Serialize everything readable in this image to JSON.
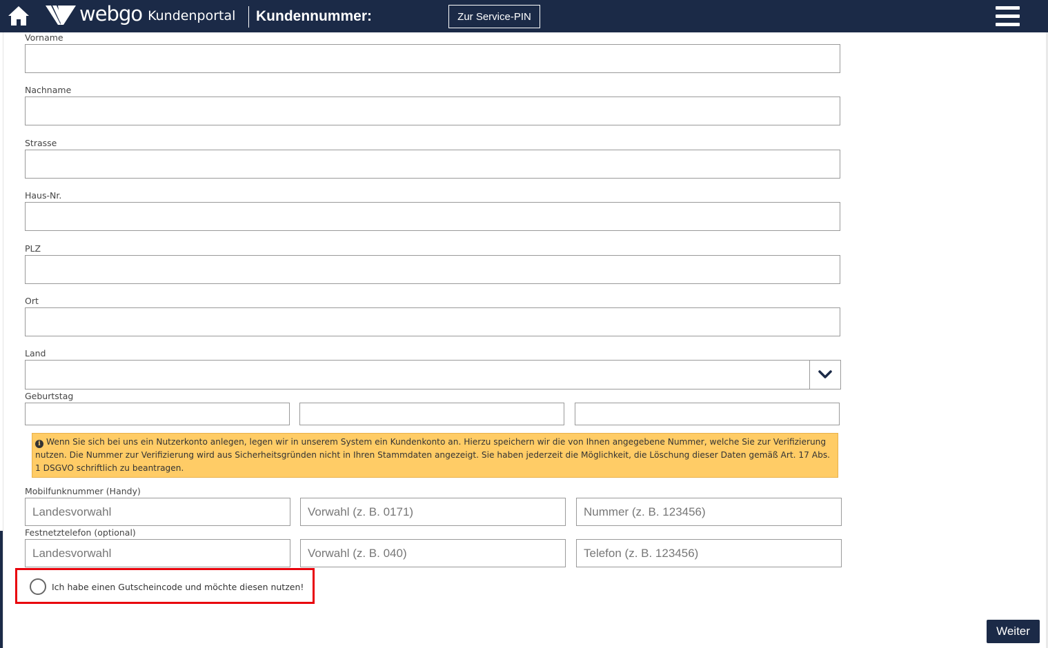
{
  "header": {
    "brand": "webgo",
    "portal": "Kundenportal",
    "customer_number_label": "Kundennummer:",
    "service_pin_button": "Zur Service-PIN",
    "background_color": "#1b2a47",
    "icons": {
      "home": "home-icon",
      "menu": "hamburger-menu-icon",
      "logo": "webgo-logo-icon"
    }
  },
  "form": {
    "first_name": {
      "label": "Vorname",
      "value": ""
    },
    "last_name": {
      "label": "Nachname",
      "value": ""
    },
    "street": {
      "label": "Strasse",
      "value": ""
    },
    "house_number": {
      "label": "Haus-Nr.",
      "value": ""
    },
    "zip": {
      "label": "PLZ",
      "value": ""
    },
    "city": {
      "label": "Ort",
      "value": ""
    },
    "country": {
      "label": "Land",
      "value": "",
      "icon": "chevron-down-icon"
    },
    "birthday": {
      "label": "Geburtstag",
      "day": "",
      "month": "",
      "year": ""
    },
    "info_text": "Wenn Sie sich bei uns ein Nutzerkonto anlegen, legen wir in unserem System ein Kundenkonto an. Hierzu speichern wir die von Ihnen angegebene Nummer, welche Sie zur Verifizierung nutzen. Die Nummer zur Verifizierung wird aus Sicherheitsgründen nicht in Ihren Stammdaten angezeigt. Sie haben jederzeit die Möglichkeit, die Löschung dieser Daten gemäß Art. 17 Abs. 1 DSGVO schriftlich zu beantragen.",
    "info_color": "#ffcc66",
    "mobile": {
      "label": "Mobilfunknummer (Handy)",
      "country_code_placeholder": "Landesvorwahl",
      "area_code_placeholder": "Vorwahl (z. B. 0171)",
      "number_placeholder": "Nummer (z. B. 123456)"
    },
    "landline": {
      "label": "Festnetztelefon (optional)",
      "country_code_placeholder": "Landesvorwahl",
      "area_code_placeholder": "Vorwahl (z. B. 040)",
      "number_placeholder": "Telefon (z. B. 123456)"
    },
    "voucher_label": "Ich habe einen Gutscheincode und möchte diesen nutzen!",
    "voucher_checked": false,
    "highlight_color": "#e8000b",
    "next_button": "Weiter"
  }
}
